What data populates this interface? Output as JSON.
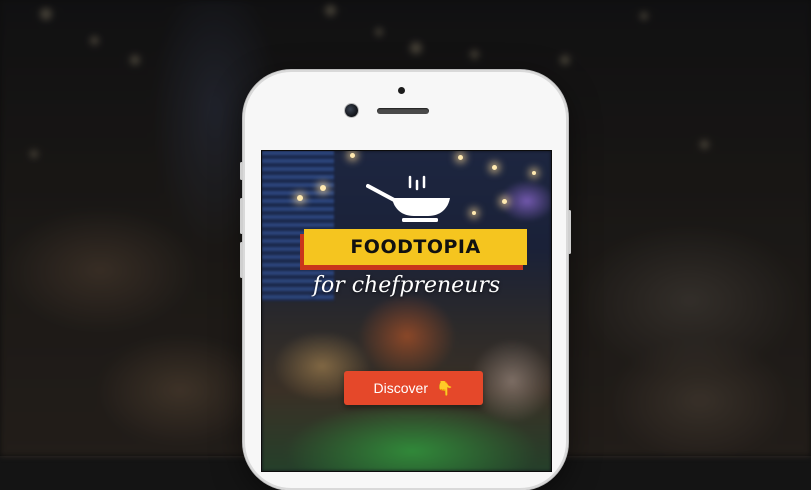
{
  "app": {
    "brand": "FOODTOPIA",
    "tagline": "for chefpreneurs",
    "cta": {
      "label": "Discover",
      "icon": "pointing-down-hand-icon",
      "glyph": "👇"
    }
  },
  "colors": {
    "banner": "#f5c51f",
    "banner_shadow": "#c9361b",
    "cta": "#e5482a",
    "phone_body": "#f7f7f7"
  },
  "icons": {
    "logo": "wok-pan-icon"
  }
}
